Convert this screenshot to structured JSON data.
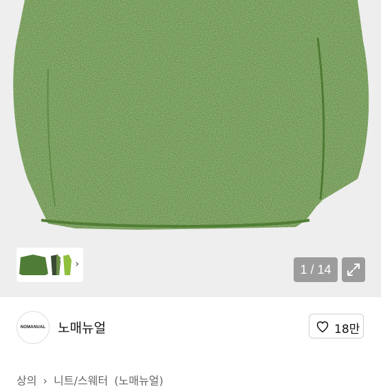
{
  "gallery": {
    "counter": "1 / 14",
    "fullscreen_icon": "expand-icon",
    "thumb_strip_chevron": "chevron-right-icon",
    "sweater_color": "#5b8a3c"
  },
  "seller": {
    "logo_text": "NOMANUAL",
    "name": "노매뉴얼",
    "follow_count": "18만",
    "follow_icon": "heart-icon"
  },
  "breadcrumb": {
    "items": [
      "상의",
      "›",
      "니트/스웨터",
      "(노매뉴얼)"
    ]
  }
}
